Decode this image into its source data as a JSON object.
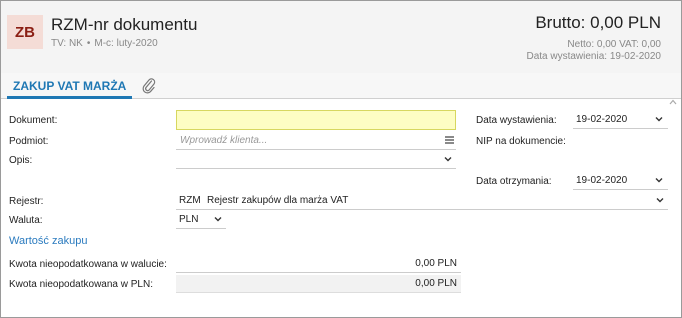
{
  "header": {
    "badge": "ZB",
    "title": "RZM-nr dokumentu",
    "tv_label": "TV: NK",
    "separator": "•",
    "period": "M-c: luty-2020",
    "brutto": "Brutto: 0,00 PLN",
    "netto": "Netto: 0,00 VAT: 0,00",
    "data_wystawienia": "Data wystawienia: 19-02-2020"
  },
  "tabs": {
    "active": "ZAKUP VAT MARŻA"
  },
  "form": {
    "dokument_label": "Dokument:",
    "dokument_value": "",
    "podmiot_label": "Podmiot:",
    "podmiot_placeholder": "Wprowadź klienta...",
    "opis_label": "Opis:",
    "rejestr_label": "Rejestr:",
    "rejestr_code": "RZM",
    "rejestr_name": "Rejestr zakupów dla marża VAT",
    "waluta_label": "Waluta:",
    "waluta_value": "PLN",
    "wartosc_zakupu": "Wartość zakupu",
    "kwota_waluta_label": "Kwota nieopodatkowana w walucie:",
    "kwota_waluta_value": "0,00 PLN",
    "kwota_pln_label": "Kwota nieopodatkowana w PLN:",
    "kwota_pln_value": "0,00 PLN",
    "data_wystawienia_label": "Data wystawienia:",
    "data_wystawienia_value": "19-02-2020",
    "nip_label": "NIP na dokumencie:",
    "data_otrzymania_label": "Data otrzymania:",
    "data_otrzymania_value": "19-02-2020"
  },
  "icons": {
    "attachment": "paperclip-icon",
    "dropdown": "chevron-down-icon",
    "menu": "hamburger-icon",
    "scroll": "scroll-up-icon"
  },
  "colors": {
    "accent": "#1f78b4",
    "badge_bg": "#f4dcd6",
    "badge_fg": "#8b1f14",
    "required_field": "#fdfdc3"
  }
}
